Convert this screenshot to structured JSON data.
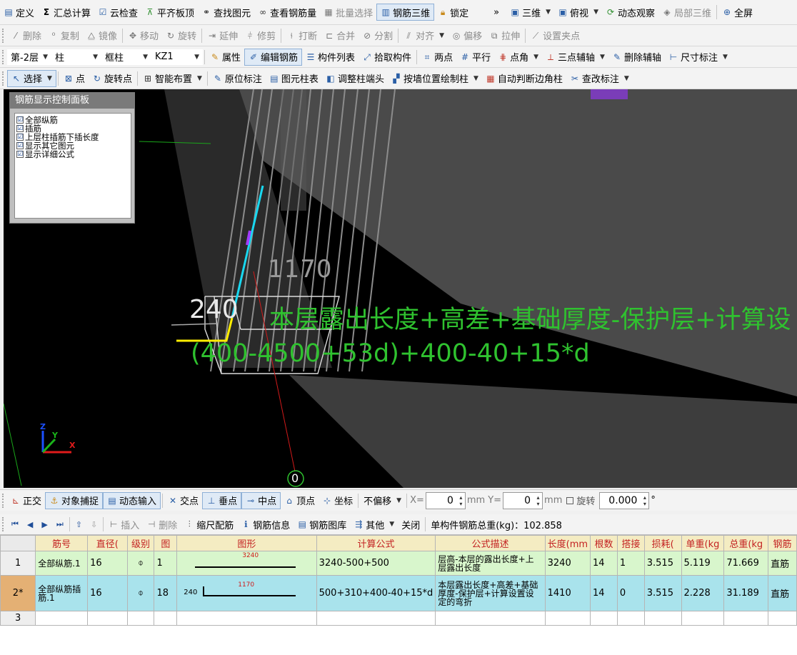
{
  "toolbar_main": {
    "define": "定义",
    "sum_calc": "汇总计算",
    "cloud_check": "云检查",
    "align_slab": "平齐板顶",
    "find_element": "查找图元",
    "view_rebar_qty": "查看钢筋量",
    "batch_select": "批量选择",
    "rebar_3d": "钢筋三维",
    "lock": "锁定",
    "more": "»",
    "view_3d": "三维",
    "top_view": "俯视",
    "dynamic_observe": "动态观察",
    "local_3d": "局部三维",
    "full_screen": "全屏"
  },
  "toolbar_edit": {
    "delete": "删除",
    "copy": "复制",
    "mirror": "镜像",
    "move": "移动",
    "rotate": "旋转",
    "extend": "延伸",
    "trim": "修剪",
    "break": "打断",
    "merge": "合并",
    "split": "分割",
    "align": "对齐",
    "offset": "偏移",
    "stretch": "拉伸",
    "set_grip": "设置夹点"
  },
  "toolbar_layer": {
    "floor": "第-2层",
    "category": "柱",
    "type": "框柱",
    "element": "KZ1",
    "properties": "属性",
    "edit_rebar": "编辑钢筋",
    "element_list": "构件列表",
    "pick_element": "拾取构件",
    "two_points": "两点",
    "parallel": "平行",
    "point_angle": "点角",
    "three_point_axis": "三点辅轴",
    "delete_axis": "删除辅轴",
    "dimension": "尺寸标注"
  },
  "toolbar_draw": {
    "select": "选择",
    "point": "点",
    "rotate_point": "旋转点",
    "smart_layout": "智能布置",
    "in_place_label": "原位标注",
    "element_column_table": "图元柱表",
    "adjust_column_end": "调整柱端头",
    "draw_by_wall": "按墙位置绘制柱",
    "auto_corner_column": "自动判断边角柱",
    "edit_label": "查改标注"
  },
  "rebar_panel": {
    "title": "钢筋显示控制面板",
    "items": [
      {
        "label": "全部纵筋",
        "checked": "☑"
      },
      {
        "label": "插筋",
        "checked": "☑"
      },
      {
        "label": "上层柱插筋下插长度",
        "checked": "☑"
      },
      {
        "label": "显示其它图元",
        "checked": "☑"
      },
      {
        "label": "显示详细公式",
        "checked": "☑"
      }
    ]
  },
  "viewport": {
    "dim_1170": "1170",
    "dim_240": "240",
    "formula_desc": "本层露出长度+高差+基础厚度-保护层+计算设",
    "formula_expr": "(400-4500+53d)+400-40+15*d",
    "origin_label": "0",
    "axis_z": "Z",
    "axis_y": "Y",
    "axis_x": "X",
    "colors": {
      "highlight_yellow": "#ffee00",
      "highlight_cyan": "#19d8f0",
      "formula_green": "#2fc22f",
      "wall_gray": "#4a4a4a",
      "rebar_gray": "#8c8c8c",
      "axis_red": "#d11a1a"
    }
  },
  "snap_bar": {
    "ortho": "正交",
    "object_snap": "对象捕捉",
    "dynamic_input": "动态输入",
    "intersection": "交点",
    "perpendicular": "垂点",
    "midpoint": "中点",
    "vertex": "顶点",
    "coordinate": "坐标",
    "no_offset": "不偏移",
    "x_label": "X=",
    "x_value": "0",
    "x_unit": "mm",
    "y_label": "Y=",
    "y_value": "0",
    "y_unit": "mm",
    "rotate_label": "旋转",
    "rotate_value": "0.000",
    "degree": "°"
  },
  "grid_toolbar": {
    "insert": "插入",
    "delete": "删除",
    "scale_rebar": "缩尺配筋",
    "rebar_info": "钢筋信息",
    "rebar_library": "钢筋图库",
    "other": "其他",
    "close": "关闭",
    "total_weight": "单构件钢筋总重(kg)：102.858"
  },
  "table": {
    "headers": [
      "筋号",
      "直径(",
      "级别",
      "图",
      "图形",
      "计算公式",
      "公式描述",
      "长度(mm",
      "根数",
      "搭接",
      "损耗(",
      "单重(kg",
      "总重(kg",
      "钢筋"
    ],
    "rows": [
      {
        "num": "1",
        "name": "全部纵筋.1",
        "diameter": "16",
        "grade": "⌽",
        "figure": "1",
        "shape_value": "3240",
        "shape_left": "",
        "formula": "3240-500+500",
        "description": "层高-本层的露出长度+上层露出长度",
        "length": "3240",
        "count": "14",
        "lap": "1",
        "loss": "3.515",
        "unit_weight": "5.119",
        "total_weight": "71.669",
        "rebar": "直筋"
      },
      {
        "num": "2*",
        "name": "全部纵筋插筋.1",
        "diameter": "16",
        "grade": "⌽",
        "figure": "18",
        "shape_value": "1170",
        "shape_left": "240",
        "formula": "500+310+400-40+15*d",
        "description": "本层露出长度+高差+基础厚度-保护层+计算设置设定的弯折",
        "length": "1410",
        "count": "14",
        "lap": "0",
        "loss": "3.515",
        "unit_weight": "2.228",
        "total_weight": "31.189",
        "rebar": "直筋"
      },
      {
        "num": "3",
        "name": "",
        "diameter": "",
        "grade": "",
        "figure": "",
        "shape_value": "",
        "shape_left": "",
        "formula": "",
        "description": "",
        "length": "",
        "count": "",
        "lap": "",
        "loss": "",
        "unit_weight": "",
        "total_weight": "",
        "rebar": ""
      }
    ]
  }
}
